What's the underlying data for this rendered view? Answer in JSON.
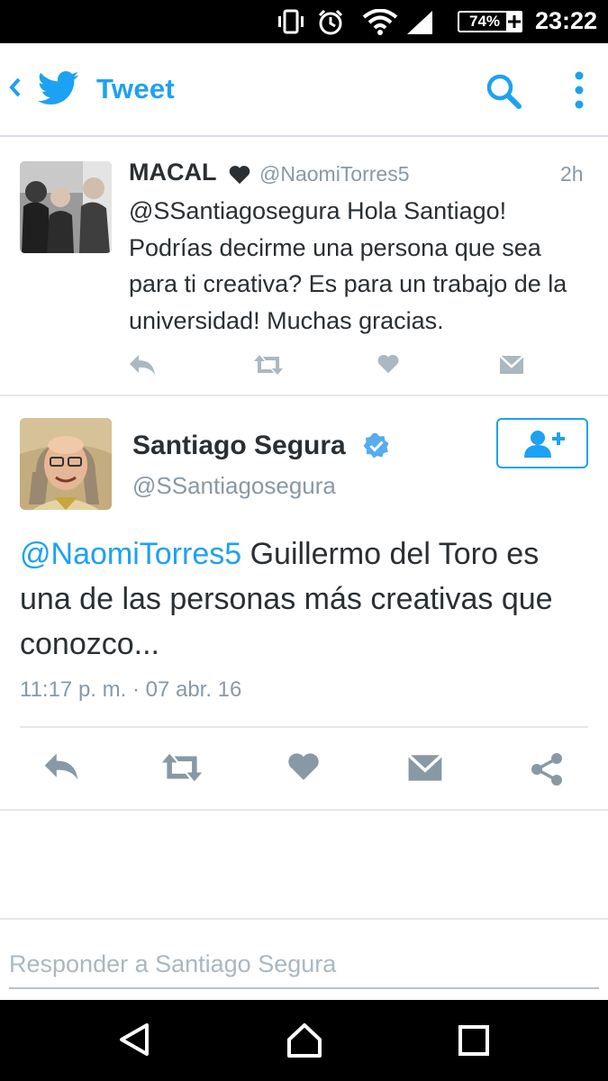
{
  "status_bar": {
    "battery_percent": "74%",
    "time": "23:22",
    "icons": [
      "vibrate-icon",
      "alarm-icon",
      "wifi-icon",
      "signal-icon",
      "battery-icon"
    ]
  },
  "app_bar": {
    "title": "Tweet",
    "icons": [
      "back-icon",
      "twitter-bird-icon",
      "search-icon",
      "more-vert-icon"
    ],
    "accent_color": "#1da1f2"
  },
  "reply_tweet": {
    "name": "MACAL",
    "handle": "@NaomiTorres5",
    "time": "2h",
    "text": "@SSantiagosegura Hola Santiago! Podrías decirme una persona que sea para ti creativa? Es para un trabajo de la universidad! Muchas gracias.",
    "actions": [
      "reply-icon",
      "retweet-icon",
      "like-icon",
      "message-icon"
    ]
  },
  "main_tweet": {
    "name": "Santiago Segura",
    "verified": true,
    "handle": "@SSantiagosegura",
    "mention": "@NaomiTorres5",
    "text": " Guillermo del Toro es una de las personas más creativas que conozco...",
    "timestamp": "11:17 p. m. · 07 abr. 16",
    "follow_icon": "follow-user-icon",
    "actions": [
      "reply-icon",
      "retweet-icon",
      "like-icon",
      "message-icon",
      "share-icon"
    ]
  },
  "reply_box": {
    "placeholder": "Responder a Santiago Segura"
  },
  "nav_bar": {
    "icons": [
      "back-triangle-icon",
      "home-icon",
      "recents-icon"
    ]
  }
}
